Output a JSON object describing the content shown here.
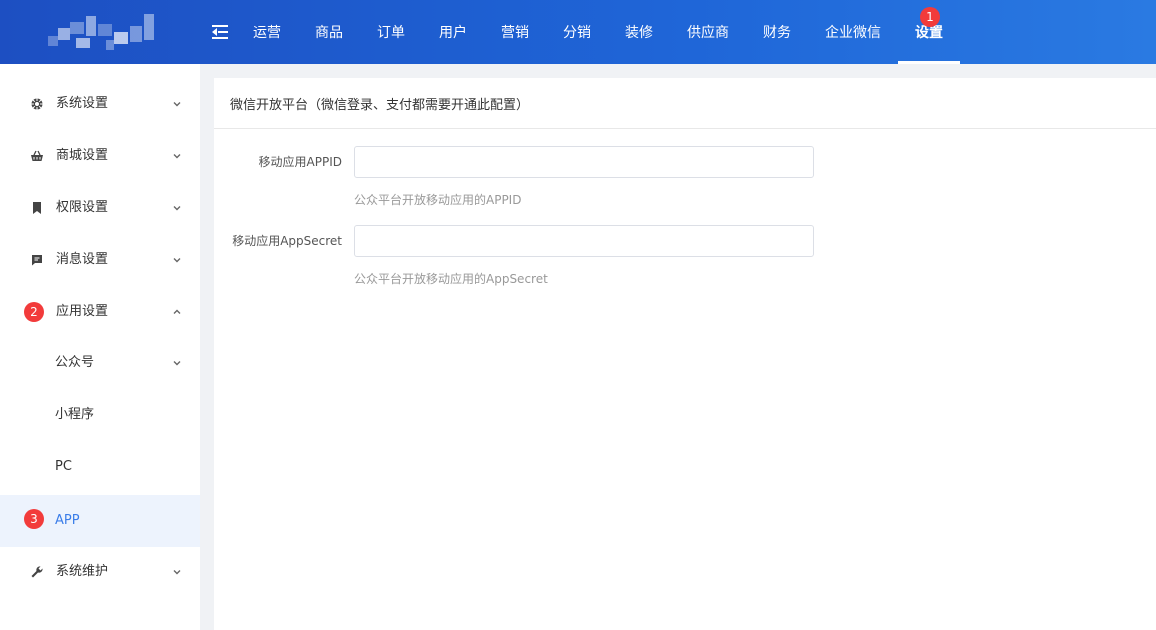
{
  "header": {
    "nav_items": [
      "运营",
      "商品",
      "订单",
      "用户",
      "营销",
      "分销",
      "装修",
      "供应商",
      "财务",
      "企业微信",
      "设置"
    ],
    "active_nav": "设置",
    "badge_1": "1"
  },
  "sidebar": {
    "items": [
      {
        "label": "系统设置",
        "icon": "gear-icon"
      },
      {
        "label": "商城设置",
        "icon": "basket-icon"
      },
      {
        "label": "权限设置",
        "icon": "bookmark-icon"
      },
      {
        "label": "消息设置",
        "icon": "message-icon"
      },
      {
        "label": "应用设置",
        "icon": "app-icon"
      },
      {
        "label": "公众号"
      },
      {
        "label": "小程序"
      },
      {
        "label": "PC"
      },
      {
        "label": "APP"
      },
      {
        "label": "系统维护",
        "icon": "wrench-icon"
      }
    ],
    "badge_2": "2",
    "badge_3": "3"
  },
  "content": {
    "title": "微信开放平台（微信登录、支付都需要开通此配置）",
    "fields": [
      {
        "label": "移动应用APPID",
        "value": "",
        "help": "公众平台开放移动应用的APPID"
      },
      {
        "label": "移动应用AppSecret",
        "value": "",
        "help": "公众平台开放移动应用的AppSecret"
      }
    ]
  },
  "colors": {
    "header": "#1f5fd2",
    "accent": "#3b7de9",
    "badge": "#f23b3b",
    "active_bg": "#edf3fd"
  }
}
